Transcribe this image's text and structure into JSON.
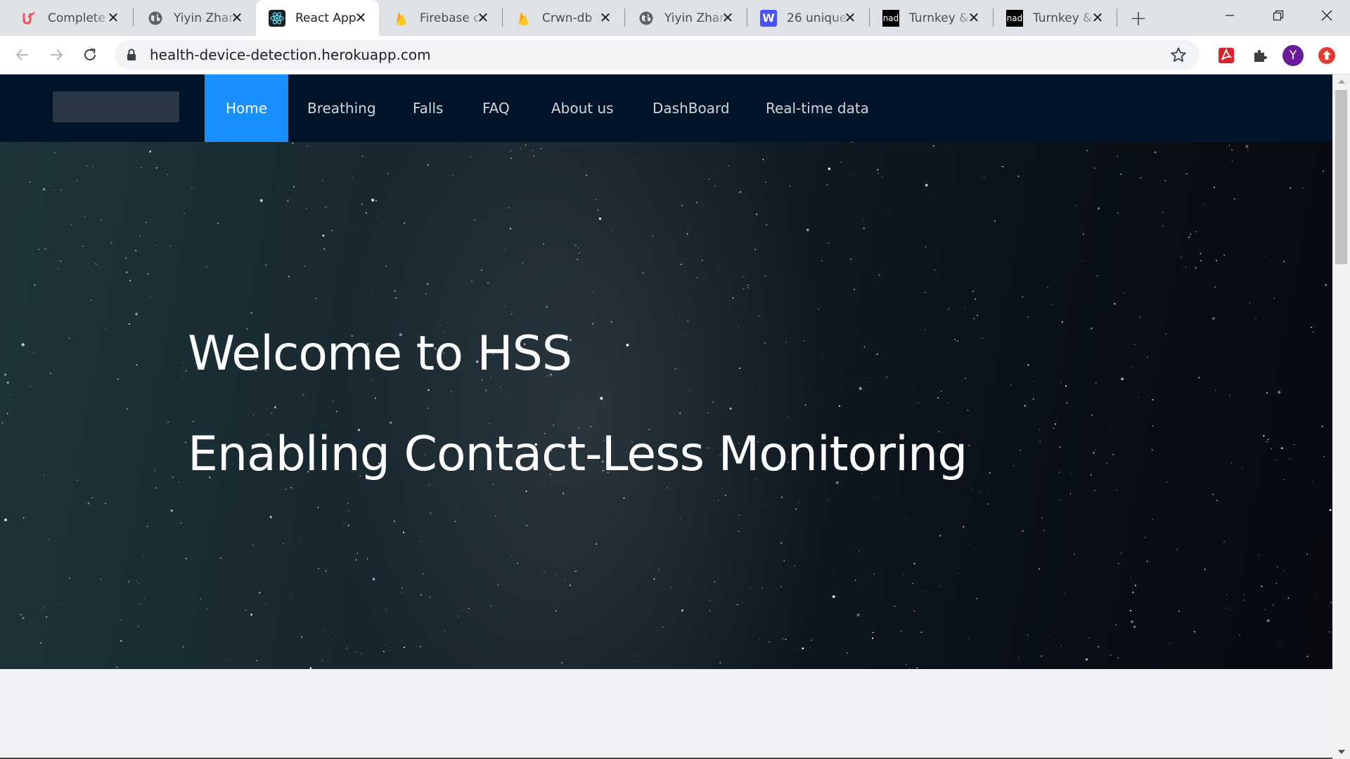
{
  "browser": {
    "tabs": [
      {
        "title": "Complete",
        "icon": "udemy-icon",
        "active": false
      },
      {
        "title": "Yiyin Zhang",
        "icon": "globe-icon",
        "active": false
      },
      {
        "title": "React App",
        "icon": "react-icon",
        "active": true
      },
      {
        "title": "Firebase console",
        "icon": "firebase-icon",
        "active": false
      },
      {
        "title": "Crwn-db",
        "icon": "firebase-icon",
        "active": false
      },
      {
        "title": "Yiyin Zhang",
        "icon": "globe-icon",
        "active": false
      },
      {
        "title": "26 unique",
        "icon": "webflow-icon",
        "active": false
      },
      {
        "title": "Turnkey &",
        "icon": "nad-icon",
        "active": false
      },
      {
        "title": "Turnkey &",
        "icon": "nad-icon",
        "active": false
      }
    ],
    "tab_icon_text": {
      "webflow": "W",
      "nad": "nad"
    },
    "url": "health-device-detection.herokuapp.com",
    "profile_initial": "Y",
    "colors": {
      "tabstrip": "#dee1e6",
      "active_tab": "#ffffff",
      "profile": "#6a1b9a"
    }
  },
  "site": {
    "nav": [
      {
        "label": "Home",
        "active": true
      },
      {
        "label": "Breathing",
        "active": false
      },
      {
        "label": "Falls",
        "active": false
      },
      {
        "label": "FAQ",
        "active": false
      },
      {
        "label": "About us",
        "active": false
      },
      {
        "label": "DashBoard",
        "active": false
      },
      {
        "label": "Real-time data",
        "active": false
      }
    ],
    "hero": {
      "title": "Welcome to HSS",
      "subtitle": "Enabling Contact-Less Monitoring"
    },
    "colors": {
      "nav_bg": "#001529",
      "nav_active": "#1890ff",
      "page_bg": "#f0f2f5"
    }
  }
}
